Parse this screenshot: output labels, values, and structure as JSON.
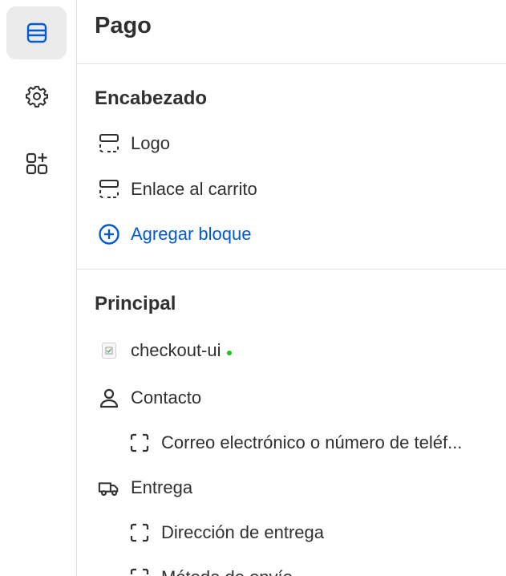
{
  "colors": {
    "accent": "#005bd3",
    "status_dot": "#1ec41e",
    "text": "#303030",
    "active_bg": "#ebebeb"
  },
  "rail": {
    "items": [
      {
        "icon": "sections-icon",
        "active": true
      },
      {
        "icon": "gear-icon",
        "active": false
      },
      {
        "icon": "apps-add-icon",
        "active": false
      }
    ]
  },
  "page": {
    "title": "Pago"
  },
  "header_section": {
    "title": "Encabezado",
    "items": [
      {
        "icon": "section-block-icon",
        "label": "Logo"
      },
      {
        "icon": "section-block-icon",
        "label": "Enlace al carrito"
      }
    ],
    "add_label": "Agregar bloque"
  },
  "main_section": {
    "title": "Principal",
    "items": [
      {
        "icon": "app-block-icon",
        "label": "checkout-ui",
        "status": "active"
      },
      {
        "icon": "person-icon",
        "label": "Contacto"
      },
      {
        "icon": "dashed-block-icon",
        "label": "Correo electrónico o número de teléf..."
      },
      {
        "icon": "truck-icon",
        "label": "Entrega"
      },
      {
        "icon": "dashed-block-icon",
        "label": "Dirección de entrega"
      },
      {
        "icon": "dashed-block-icon",
        "label": "Método de envío"
      }
    ]
  }
}
